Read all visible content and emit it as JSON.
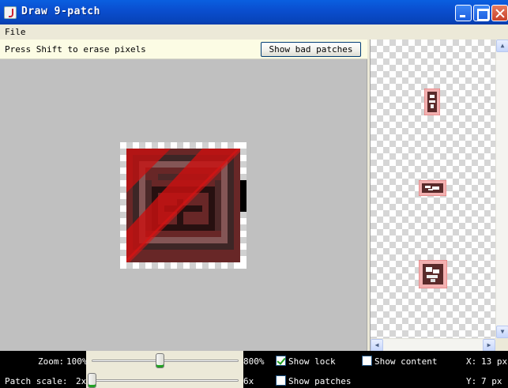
{
  "window": {
    "title": "Draw 9-patch"
  },
  "menu": {
    "items": [
      "File"
    ]
  },
  "editor": {
    "hint": "Press Shift to erase pixels",
    "show_bad_patches_label": "Show bad patches"
  },
  "statusbar": {
    "zoom_label": "Zoom:",
    "zoom_min": "100%",
    "zoom_max": "800%",
    "zoom_level_fraction": 0.46,
    "patch_scale_label": "Patch scale:",
    "patch_scale_min": "2x",
    "patch_scale_max": "6x",
    "patch_scale_level_fraction": 0.0,
    "show_lock_label": "Show lock",
    "show_lock_checked": true,
    "show_patches_label": "Show patches",
    "show_patches_checked": false,
    "show_content_label": "Show content",
    "show_content_checked": false,
    "x_label": "X:",
    "x_value": "13 px",
    "y_label": "Y:",
    "y_value": "7 px"
  },
  "colors": {
    "titlebar": "#0a4fd0",
    "editor_bg": "#c0c0c0",
    "hint_bg": "#fcfce4",
    "lock_overlay": "#cc1010",
    "status_bg": "#000000"
  },
  "icons": {
    "app": "java-cup-icon",
    "minimize": "minimize-icon",
    "maximize": "maximize-icon",
    "close": "close-icon"
  }
}
